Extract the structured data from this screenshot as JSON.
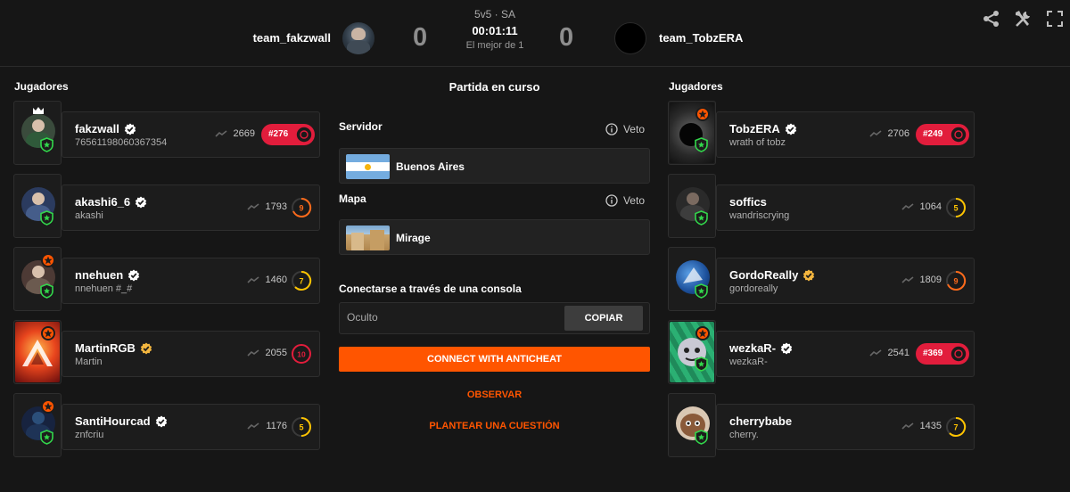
{
  "header": {
    "team_left": "team_fakzwall",
    "team_right": "team_TobzERA",
    "score_left": "0",
    "score_right": "0",
    "mode": "5v5 · SA",
    "timer": "00:01:11",
    "best_of": "El mejor de 1",
    "icons": [
      "share-icon",
      "tools-icon",
      "expand-icon"
    ]
  },
  "labels": {
    "players_left": "Jugadores",
    "players_right": "Jugadores",
    "match_status": "Partida en curso"
  },
  "server": {
    "label": "Servidor",
    "veto": "Veto",
    "value": "Buenos Aires"
  },
  "map": {
    "label": "Mapa",
    "veto": "Veto",
    "value": "Mirage"
  },
  "console": {
    "label": "Conectarse a través de una consola",
    "placeholder": "Oculto",
    "copy_label": "COPIAR"
  },
  "actions": {
    "connect_label": "CONNECT WITH ANTICHEAT",
    "watch_label": "OBSERVAR",
    "report_label": "PLANTEAR UNA CUESTIÓN"
  },
  "colors": {
    "accent": "#ff5500",
    "rank_red": "#e21d3c",
    "background": "#161616",
    "card": "#1c1c1c"
  },
  "team_left": {
    "players": [
      {
        "name": "fakzwall",
        "sub": "76561198060367354",
        "elo": "2669",
        "rank": "#276",
        "verified": "white",
        "captain": true
      },
      {
        "name": "akashi6_6",
        "sub": "akashi",
        "elo": "1793",
        "level": "9",
        "verified": "white"
      },
      {
        "name": "nnehuen",
        "sub": "nnehuen #_#",
        "elo": "1460",
        "level": "7",
        "verified": "white",
        "star": true
      },
      {
        "name": "MartinRGB",
        "sub": "Martin",
        "elo": "2055",
        "level": "10",
        "verified": "gold",
        "star": true
      },
      {
        "name": "SantiHourcad",
        "sub": "znfcriu",
        "elo": "1176",
        "level": "5",
        "verified": "white",
        "star": true
      }
    ]
  },
  "team_right": {
    "players": [
      {
        "name": "TobzERA",
        "sub": "wrath of tobz",
        "elo": "2706",
        "rank": "#249",
        "verified": "white",
        "star": true
      },
      {
        "name": "soffics",
        "sub": "wandriscrying",
        "elo": "1064",
        "level": "5"
      },
      {
        "name": "GordoReally",
        "sub": "gordoreally",
        "elo": "1809",
        "level": "9",
        "verified": "gold"
      },
      {
        "name": "wezkaR-",
        "sub": "wezkaR-",
        "elo": "2541",
        "rank": "#369",
        "verified": "white",
        "star": true
      },
      {
        "name": "cherrybabe",
        "sub": "cherry.",
        "elo": "1435",
        "level": "7"
      }
    ]
  }
}
